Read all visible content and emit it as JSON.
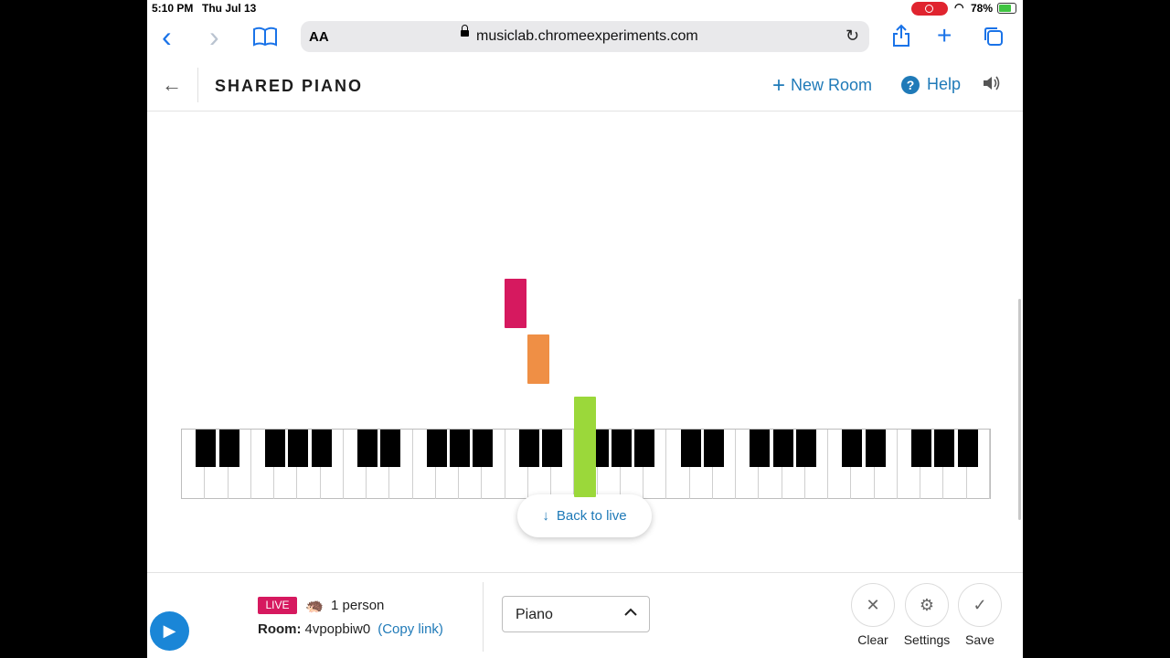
{
  "status_bar": {
    "time": "5:10 PM",
    "date": "Thu Jul 13",
    "battery": "78%"
  },
  "browser": {
    "back_icon": "‹",
    "forward_icon": "›",
    "bookmarks_icon": "📖",
    "text_size": "AA",
    "url": "musiclab.chromeexperiments.com",
    "reload_icon": "↻",
    "share_icon": "⇪",
    "new_tab_icon": "+",
    "tabs_icon": "⧉"
  },
  "header": {
    "back_icon": "←",
    "title": "SHARED PIANO",
    "new_room_icon": "+",
    "new_room_label": "New Room",
    "help_icon": "?",
    "help_label": "Help",
    "sound_icon": "🔊"
  },
  "notes": [
    {
      "color": "#d6195f"
    },
    {
      "color": "#ef8f45"
    },
    {
      "color": "#9bd83a"
    }
  ],
  "back_to_live": {
    "icon": "↓",
    "label": "Back to live"
  },
  "bottom": {
    "play_icon": "▶",
    "live_badge": "LIVE",
    "avatar_icon": "🦔",
    "people": "1 person",
    "room_label": "Room:",
    "room_id": "4vpopbiw0",
    "copy_link": "(Copy link)",
    "instrument": "Piano",
    "dropdown_icon": "⌃",
    "clear_icon": "✕",
    "clear_label": "Clear",
    "settings_icon": "⚙",
    "settings_label": "Settings",
    "save_icon": "✓",
    "save_label": "Save"
  }
}
